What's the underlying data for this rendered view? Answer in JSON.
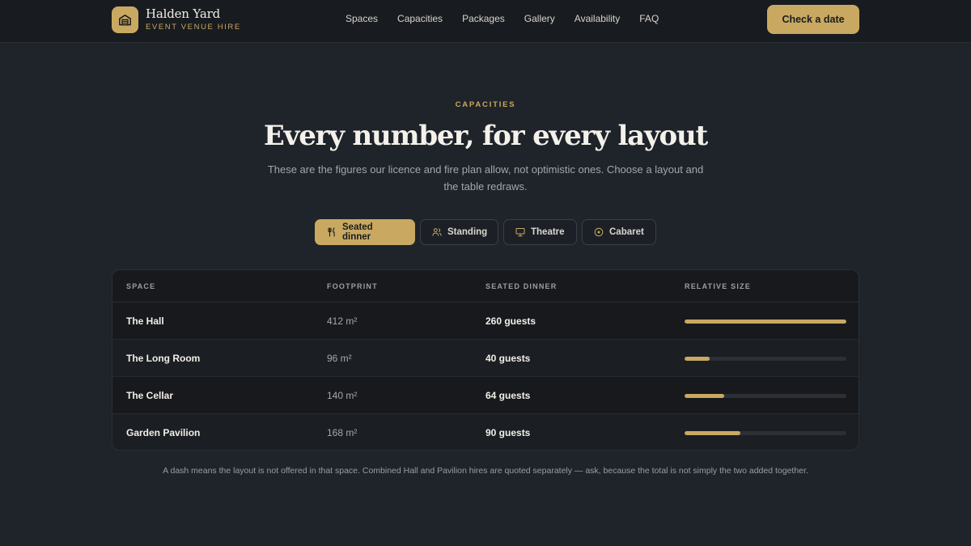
{
  "brand": {
    "name": "Halden Yard",
    "tagline": "EVENT VENUE HIRE",
    "logo_icon": "warehouse-icon"
  },
  "nav": {
    "items": [
      "Spaces",
      "Capacities",
      "Packages",
      "Gallery",
      "Availability",
      "FAQ"
    ]
  },
  "cta": {
    "label": "Check a date"
  },
  "hero": {
    "eyebrow": "CAPACITIES",
    "title": "Every number, for every layout",
    "subtitle": "These are the figures our licence and fire plan allow, not optimistic ones. Choose a layout and the table redraws."
  },
  "tabs": [
    {
      "label": "Seated dinner",
      "icon": "cutlery-icon",
      "active": true
    },
    {
      "label": "Standing",
      "icon": "people-icon",
      "active": false
    },
    {
      "label": "Theatre",
      "icon": "presentation-icon",
      "active": false
    },
    {
      "label": "Cabaret",
      "icon": "round-table-icon",
      "active": false
    }
  ],
  "table": {
    "headers": [
      "SPACE",
      "FOOTPRINT",
      "SEATED DINNER",
      "RELATIVE SIZE"
    ],
    "rows": [
      {
        "space": "The Hall",
        "footprint": "412 m²",
        "capacity": "260 guests",
        "relative": 1.0
      },
      {
        "space": "The Long Room",
        "footprint": "96 m²",
        "capacity": "40 guests",
        "relative": 0.154
      },
      {
        "space": "The Cellar",
        "footprint": "140 m²",
        "capacity": "64 guests",
        "relative": 0.246
      },
      {
        "space": "Garden Pavilion",
        "footprint": "168 m²",
        "capacity": "90 guests",
        "relative": 0.346
      }
    ]
  },
  "footnote": "A dash means the layout is not offered in that space. Combined Hall and Pavilion hires are quoted separately — ask, because the total is not simply the two added together.",
  "colors": {
    "accent": "#c9a961",
    "background": "#1f232a",
    "header": "#181b20",
    "card": "#17191d"
  }
}
